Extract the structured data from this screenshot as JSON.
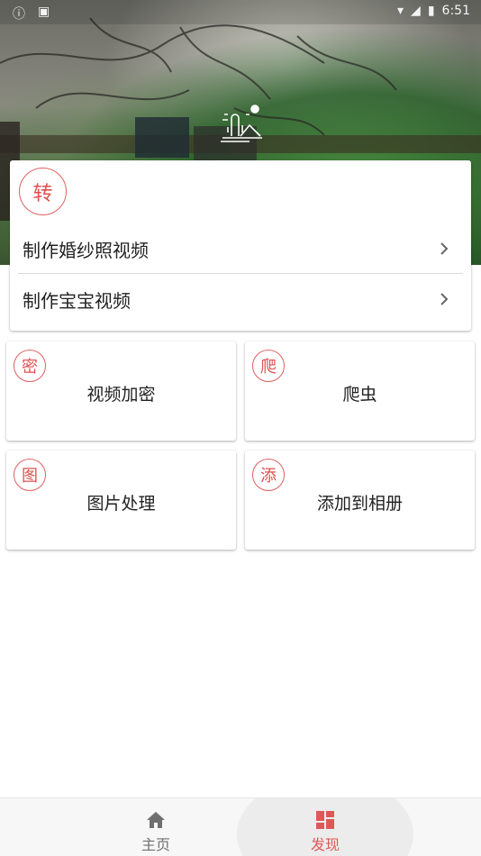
{
  "status_bar": {
    "time": "6:51"
  },
  "main_card": {
    "badge": "转",
    "items": [
      {
        "label": "制作婚纱照视频"
      },
      {
        "label": "制作宝宝视频"
      }
    ]
  },
  "tiles": [
    {
      "badge": "密",
      "title": "视频加密"
    },
    {
      "badge": "爬",
      "title": "爬虫"
    },
    {
      "badge": "图",
      "title": "图片处理"
    },
    {
      "badge": "添",
      "title": "添加到相册"
    }
  ],
  "bottom_nav": {
    "items": [
      {
        "label": "主页",
        "icon": "home-icon",
        "active": false
      },
      {
        "label": "发现",
        "icon": "discover-grid-icon",
        "active": true
      }
    ],
    "active_color": "#e05757",
    "inactive_color": "#6f6f6f"
  },
  "colors": {
    "stamp_red": "#e05050"
  }
}
